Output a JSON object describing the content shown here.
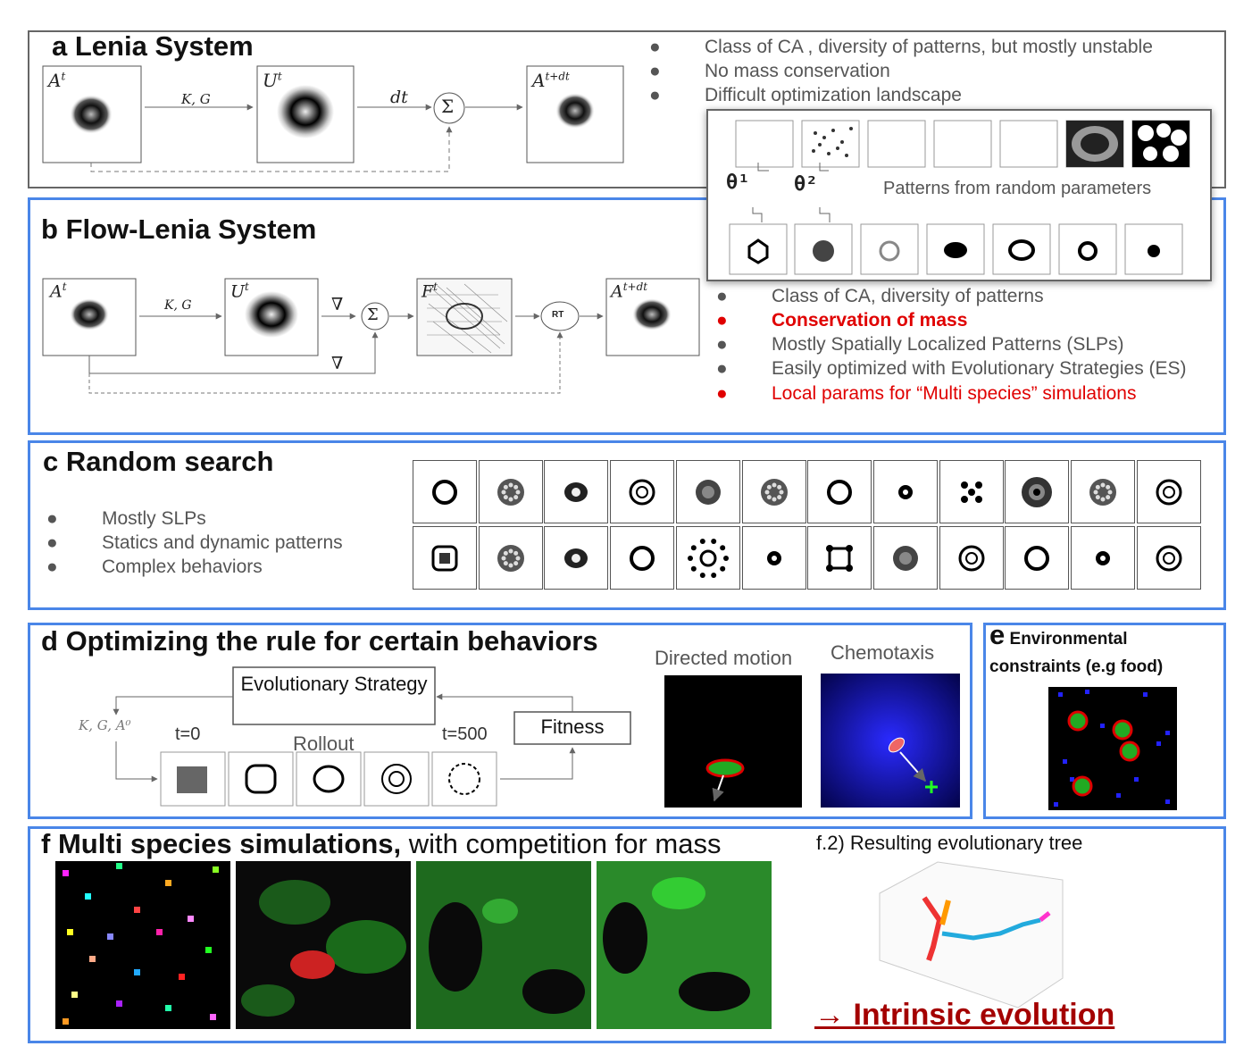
{
  "panel_a": {
    "label": "a",
    "title": "Lenia System",
    "bullets": [
      "Class of CA , diversity of patterns, but mostly unstable",
      "No mass conservation",
      "Difficult optimization landscape"
    ],
    "node_a": "A",
    "node_a_sup": "t",
    "node_u": "U",
    "node_u_sup": "t",
    "node_next": "A",
    "node_next_sup": "t+dt",
    "edge_kg": "K, G",
    "edge_dt": "dt",
    "sum_symbol": "Σ"
  },
  "inset": {
    "theta1": "θ¹",
    "theta2": "θ²",
    "caption": "Patterns from random parameters"
  },
  "panel_b": {
    "label": "b",
    "title": "Flow-Lenia System",
    "bullets": [
      "Class of CA, diversity of patterns",
      "Conservation of mass",
      "Mostly Spatially Localized Patterns (SLPs)",
      "Easily optimized with Evolutionary Strategies (ES)",
      "Local params for “Multi species” simulations"
    ],
    "node_a": "A",
    "node_a_sup": "t",
    "node_u": "U",
    "node_u_sup": "t",
    "node_f": "F",
    "node_f_sup": "t",
    "node_next": "A",
    "node_next_sup": "t+dt",
    "edge_kg": "K, G",
    "nabla": "∇",
    "sum_symbol": "Σ",
    "rt": "RT"
  },
  "panel_c": {
    "label": "c",
    "title": "Random search",
    "bullets": [
      "Mostly SLPs",
      "Statics and dynamic patterns",
      "Complex behaviors"
    ]
  },
  "panel_d": {
    "label": "d",
    "title": "Optimizing the rule for certain behaviors",
    "es_box": "Evolutionary Strategy",
    "fitness": "Fitness",
    "params": "K, G, A⁰",
    "t0": "t=0",
    "rollout": "Rollout",
    "t500": "t=500",
    "directed": "Directed motion",
    "chemotaxis": "Chemotaxis"
  },
  "panel_e": {
    "label": "e",
    "title": "Environmental constraints (e.g food)"
  },
  "panel_f": {
    "label": "f",
    "title": "Multi species simulations,",
    "title_rest": " with competition for mass",
    "tree_caption": "f.2) Resulting evolutionary tree",
    "evolution": "→ Intrinsic evolution"
  },
  "colors": {
    "panel_border": "#4a86e8",
    "highlight_red": "#e00000",
    "evolution_red": "#a40000"
  }
}
